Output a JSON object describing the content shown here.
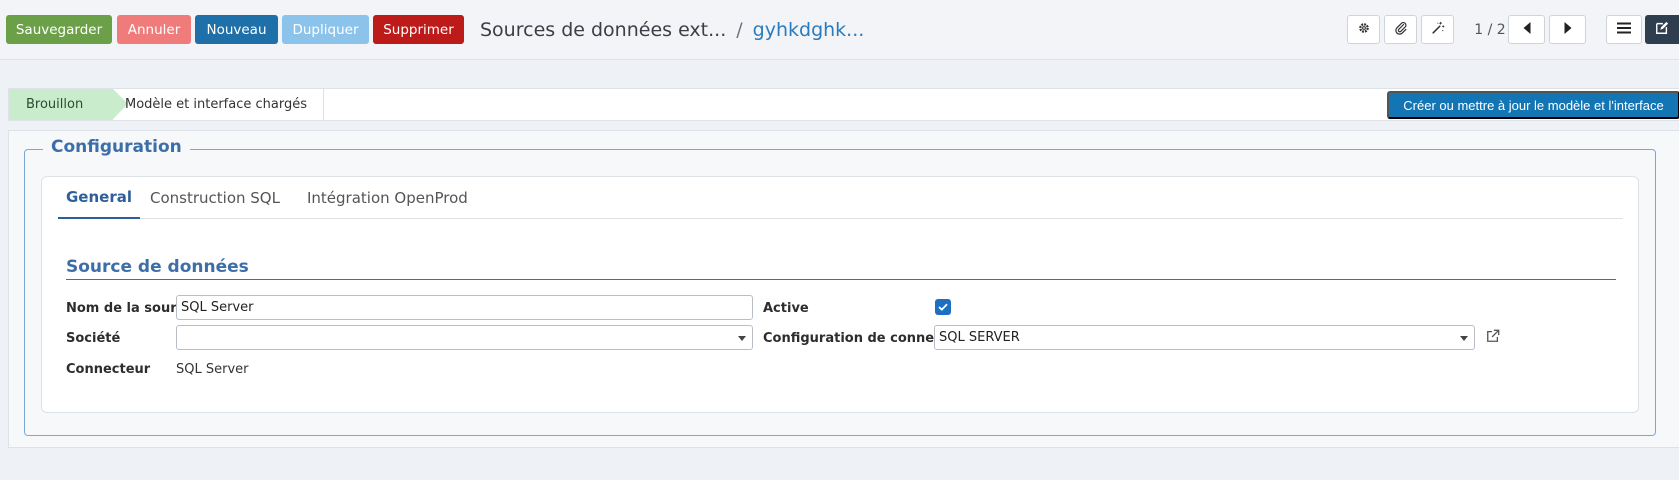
{
  "toolbar": {
    "save_label": "Sauvegarder",
    "cancel_label": "Annuler",
    "new_label": "Nouveau",
    "duplicate_label": "Dupliquer",
    "delete_label": "Supprimer"
  },
  "breadcrumb": {
    "parent": "Sources de données ext...",
    "separator": "/",
    "current": "gyhkdghk..."
  },
  "tools": {
    "settings_icon": "gear-icon",
    "attachment_icon": "paperclip-icon",
    "wand_icon": "magic-wand-icon"
  },
  "pager": {
    "text": "1 / 2"
  },
  "statusbar": {
    "stages": [
      "Brouillon",
      "Modèle et interface chargés"
    ],
    "action_label": "Créer ou mettre à jour le modèle et l'interface"
  },
  "form": {
    "fieldset_title": "Configuration",
    "tabs": [
      "General",
      "Construction SQL",
      "Intégration OpenProd"
    ],
    "section_title": "Source de données",
    "fields": {
      "source_name_label": "Nom de la source",
      "source_name_value": "SQL Server",
      "company_label": "Société",
      "company_value": "",
      "connector_label": "Connecteur",
      "connector_value": "SQL Server",
      "active_label": "Active",
      "active_checked": true,
      "connection_label": "Configuration de connexion",
      "connection_value": "SQL SERVER"
    }
  },
  "colors": {
    "save": "#6ba048",
    "cancel": "#f07b7b",
    "new": "#1f6fa8",
    "duplicate": "#8cc3ea",
    "delete": "#bd1a1a",
    "accent": "#3d6ea8"
  }
}
